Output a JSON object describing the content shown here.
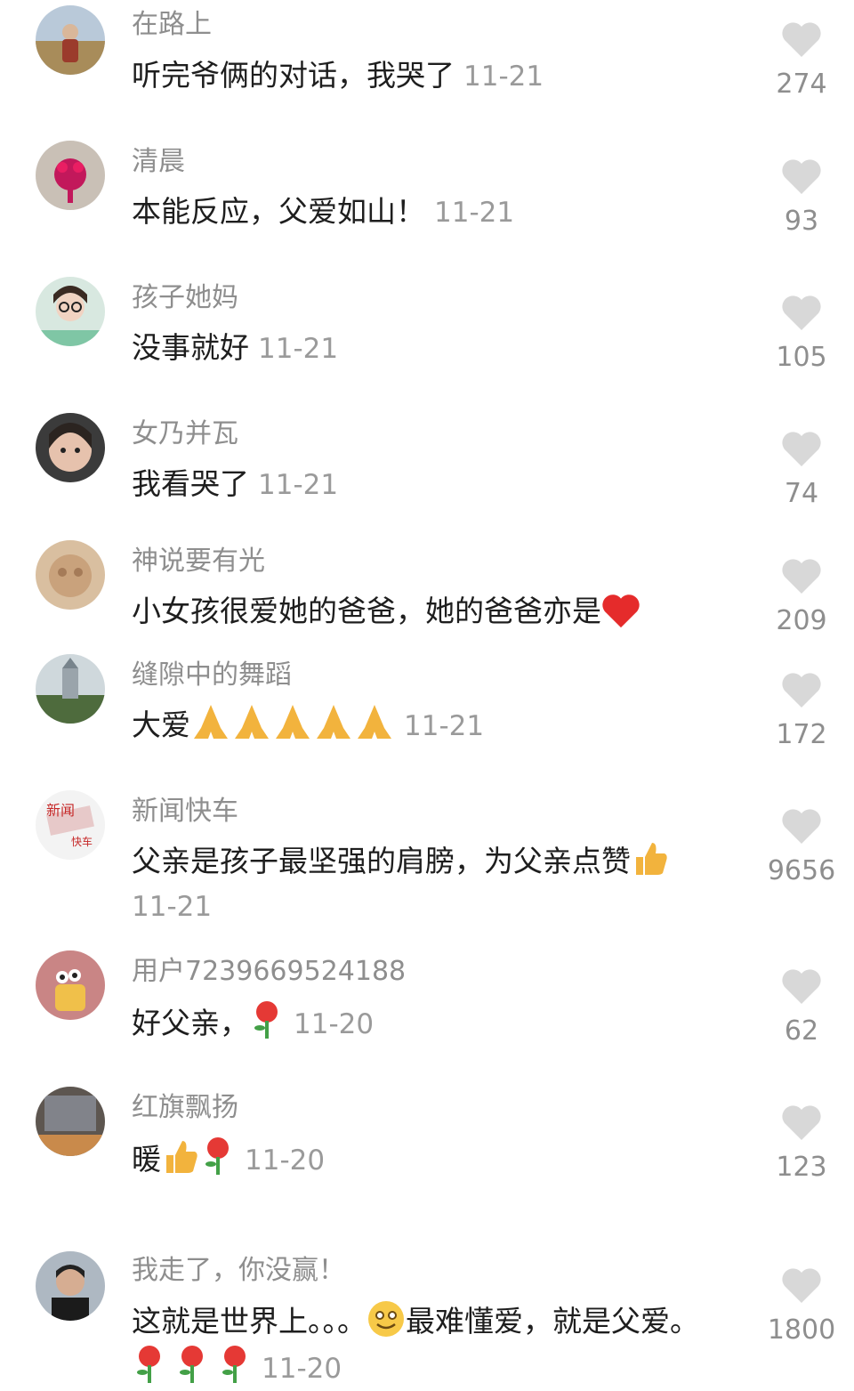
{
  "comments": [
    {
      "user": "在路上",
      "text": "听完爷俩的对话，我哭了",
      "date": "11-21",
      "likes": "274"
    },
    {
      "user": "清晨",
      "text": "本能反应，父爱如山！",
      "date": "11-21",
      "likes": "93"
    },
    {
      "user": "孩子她妈",
      "text": "没事就好",
      "date": "11-21",
      "likes": "105"
    },
    {
      "user": "女乃并瓦",
      "text": "我看哭了",
      "date": "11-21",
      "likes": "74"
    },
    {
      "user": "神说要有光",
      "text": "小女孩很爱她的爸爸，她的爸爸亦是",
      "date": "",
      "likes": "209",
      "emoji": "red-heart"
    },
    {
      "user": "缝隙中的舞蹈",
      "text": "大爱",
      "date": "11-21",
      "likes": "172",
      "emoji": "folded-hands x5"
    },
    {
      "user": "新闻快车",
      "text": "父亲是孩子最坚强的肩膀，为父亲点赞",
      "date": "11-21",
      "likes": "9656",
      "emoji": "thumbs-up"
    },
    {
      "user": "用户7239669524188",
      "text": "好父亲，",
      "date": "11-20",
      "likes": "62",
      "emoji": "rose"
    },
    {
      "user": "红旗飘扬",
      "text": "暖",
      "date": "11-20",
      "likes": "123",
      "emoji": "thumbs-up, rose"
    },
    {
      "user": "我走了，你没赢！",
      "text": "这就是世界上。。。",
      "text2": "最难懂爱，就是父爱。",
      "date": "11-20",
      "likes": "1800",
      "emoji": "smile, rose x3"
    }
  ],
  "colors": {
    "username": "#8e8e8e",
    "text": "#1e1e1e",
    "date": "#9a9a9a",
    "heart": "#d8d8d8"
  }
}
